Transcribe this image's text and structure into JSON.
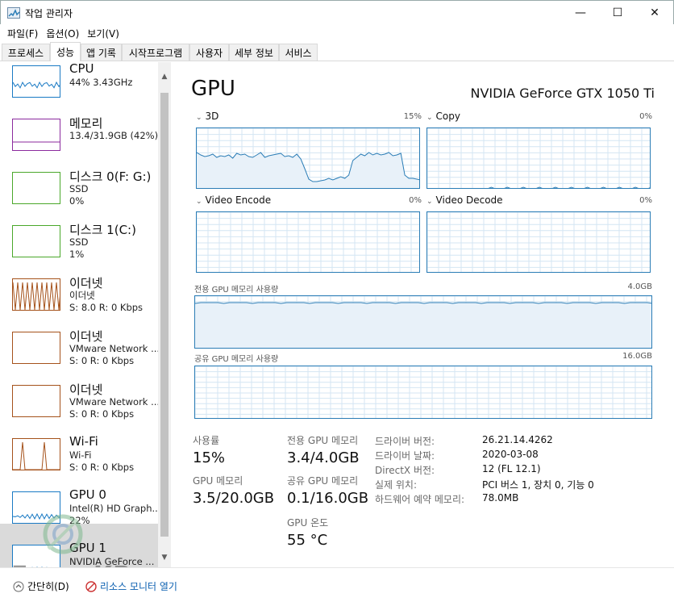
{
  "window": {
    "title": "작업 관리자",
    "minimize_glyph": "—",
    "maximize_glyph": "☐",
    "close_glyph": "✕"
  },
  "menu": [
    {
      "label": "파일(F)"
    },
    {
      "label": "옵션(O)"
    },
    {
      "label": "보기(V)"
    }
  ],
  "tabs": [
    {
      "label": "프로세스",
      "active": false
    },
    {
      "label": "성능",
      "active": true
    },
    {
      "label": "앱 기록",
      "active": false
    },
    {
      "label": "시작프로그램",
      "active": false
    },
    {
      "label": "사용자",
      "active": false
    },
    {
      "label": "세부 정보",
      "active": false
    },
    {
      "label": "서비스",
      "active": false
    }
  ],
  "sidebar": {
    "items": [
      {
        "title": "CPU",
        "line1": "44% 3.43GHz",
        "line2": "",
        "line3": "",
        "color": "#1a7ac4"
      },
      {
        "title": "메모리",
        "line1": "13.4/31.9GB (42%)",
        "line2": "",
        "line3": "",
        "color": "#8b2a9e"
      },
      {
        "title": "디스크 0(F: G:)",
        "line1": "SSD",
        "line2": "0%",
        "line3": "",
        "color": "#4aa82a"
      },
      {
        "title": "디스크 1(C:)",
        "line1": "SSD",
        "line2": "1%",
        "line3": "",
        "color": "#4aa82a"
      },
      {
        "title": "이더넷",
        "line1": "이더넷",
        "line2": "S: 8.0 R: 0 Kbps",
        "line3": "",
        "color": "#a5521b"
      },
      {
        "title": "이더넷",
        "line1": "VMware Network ...",
        "line2": "S: 0 R: 0 Kbps",
        "line3": "",
        "color": "#a5521b"
      },
      {
        "title": "이더넷",
        "line1": "VMware Network ...",
        "line2": "S: 0 R: 0 Kbps",
        "line3": "",
        "color": "#a5521b"
      },
      {
        "title": "Wi-Fi",
        "line1": "Wi-Fi",
        "line2": "S: 0 R: 0 Kbps",
        "line3": "",
        "color": "#a5521b"
      },
      {
        "title": "GPU 0",
        "line1": "Intel(R) HD Graph...",
        "line2": "22%",
        "line3": "",
        "color": "#1a7ac4"
      },
      {
        "title": "GPU 1",
        "line1": "NVIDIA GeForce ...",
        "line2": "",
        "line3": "",
        "color": "#1a7ac4"
      }
    ],
    "scroll_up": "▲",
    "scroll_down": "▼"
  },
  "main": {
    "title": "GPU",
    "model": "NVIDIA GeForce GTX 1050 Ti",
    "graphs": {
      "g3d": {
        "label": "3D",
        "pct": "15%"
      },
      "copy": {
        "label": "Copy",
        "pct": "0%"
      },
      "encode": {
        "label": "Video Encode",
        "pct": "0%"
      },
      "decode": {
        "label": "Video Decode",
        "pct": "0%"
      }
    },
    "chevron": "⌄",
    "dedicated_mem_label": "전용 GPU 메모리 사용량",
    "dedicated_mem_max": "4.0GB",
    "shared_mem_label": "공유 GPU 메모리 사용량",
    "shared_mem_max": "16.0GB",
    "stats": {
      "utilization_label": "사용률",
      "utilization_value": "15%",
      "dedicated_label": "전용 GPU 메모리",
      "dedicated_value": "3.4/4.0GB",
      "gpu_mem_label": "GPU 메모리",
      "gpu_mem_value": "3.5/20.0GB",
      "shared_label": "공유 GPU 메모리",
      "shared_value": "0.1/16.0GB",
      "temp_label": "GPU 온도",
      "temp_value": "55 °C"
    },
    "info": [
      {
        "key": "드라이버 버전:",
        "value": "26.21.14.4262"
      },
      {
        "key": "드라이버 날짜:",
        "value": "2020-03-08"
      },
      {
        "key": "DirectX 버전:",
        "value": "12 (FL 12.1)"
      },
      {
        "key": "실제 위치:",
        "value": "PCI 버스 1, 장치 0, 기능 0"
      },
      {
        "key": "하드웨어 예약 메모리:",
        "value": "78.0MB"
      }
    ]
  },
  "footer": {
    "less_details": "간단히(D)",
    "resource_monitor": "리소스 모니터 열기"
  },
  "watermark": {
    "text": "FocusKR"
  },
  "colors": {
    "accent": "#2b7db6",
    "graph_fill": "#e8f1f9",
    "grid": "#d4e6f3"
  }
}
